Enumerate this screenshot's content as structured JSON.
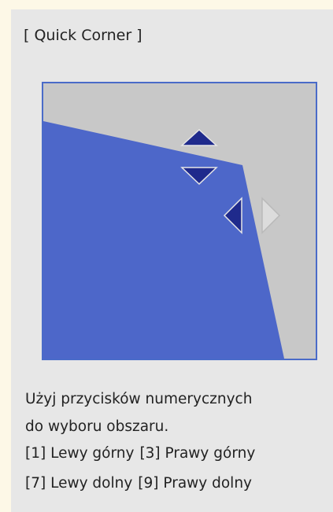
{
  "dialog": {
    "title": "[ Quick Corner ]"
  },
  "preview": {
    "shape_color": "#4d67c9",
    "background_color": "#c8c8c8",
    "border_color": "#4a6bc8",
    "active_arrow_color": "#1f2a8c",
    "inactive_arrow_color": "#dcdcdc",
    "arrows": [
      {
        "name": "arrow-up-icon",
        "state": "active"
      },
      {
        "name": "arrow-down-icon",
        "state": "active"
      },
      {
        "name": "arrow-left-icon",
        "state": "active"
      },
      {
        "name": "arrow-right-icon",
        "state": "inactive"
      }
    ]
  },
  "instructions": {
    "line1": "Użyj przycisków numerycznych",
    "line2": "do wyboru obszaru.",
    "top_left": "[1] Lewy górny",
    "top_right": "[3] Prawy górny",
    "bottom_left": "[7] Lewy dolny",
    "bottom_right": "[9] Prawy dolny"
  }
}
